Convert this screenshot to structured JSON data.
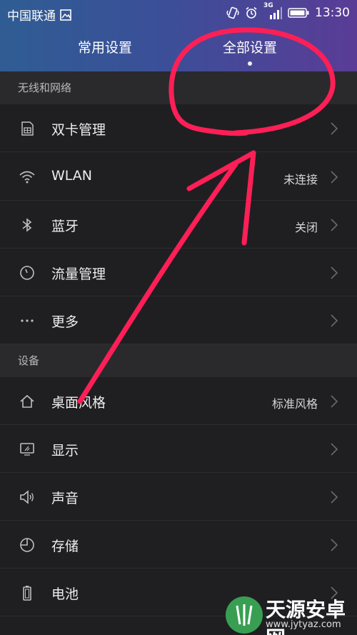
{
  "status_bar": {
    "carrier": "中国联通",
    "network": "3G",
    "time": "13:30"
  },
  "tabs": [
    {
      "label": "常用设置",
      "selected": false
    },
    {
      "label": "全部设置",
      "selected": true
    }
  ],
  "sections": {
    "wireless": "无线和网络",
    "device": "设备"
  },
  "rows": [
    {
      "label": "双卡管理",
      "value": "",
      "icon": "sim-card-icon"
    },
    {
      "label": "WLAN",
      "value": "未连接",
      "icon": "wifi-icon"
    },
    {
      "label": "蓝牙",
      "value": "关闭",
      "icon": "bluetooth-icon"
    },
    {
      "label": "流量管理",
      "value": "",
      "icon": "data-usage-icon"
    },
    {
      "label": "更多",
      "value": "",
      "icon": "more-icon"
    },
    {
      "label": "桌面风格",
      "value": "标准风格",
      "icon": "home-icon"
    },
    {
      "label": "显示",
      "value": "",
      "icon": "display-icon"
    },
    {
      "label": "声音",
      "value": "",
      "icon": "speaker-icon"
    },
    {
      "label": "存储",
      "value": "",
      "icon": "storage-icon"
    },
    {
      "label": "电池",
      "value": "",
      "icon": "battery-icon"
    },
    {
      "label": "",
      "value": "",
      "icon": "app-manager-icon"
    }
  ],
  "watermark": {
    "name": "天源安卓网",
    "url": "www.jytyaz.com"
  },
  "colors": {
    "header_start": "#2f5d93",
    "header_end": "#5a3c96",
    "annotation": "#ff1f57",
    "background": "#1f1f22"
  }
}
